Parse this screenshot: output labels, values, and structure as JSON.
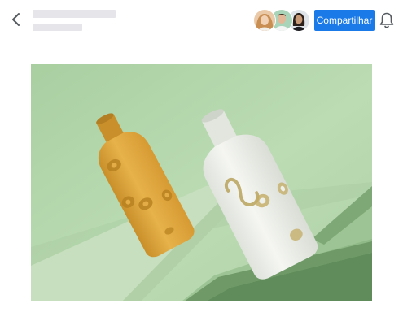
{
  "header": {
    "share_label": "Compartilhar"
  },
  "icons": {
    "back": "chevron-left-icon",
    "notifications": "bell-icon"
  },
  "collaborators": {
    "count": 3
  },
  "colors": {
    "accent": "#1a7ae8",
    "skeleton": "#e5e5ea",
    "divider": "#dcdcdc",
    "bottle_yellow": "#e0a93a",
    "bottle_white": "#eef0ec",
    "backdrop_green": "#b6d6ae"
  }
}
